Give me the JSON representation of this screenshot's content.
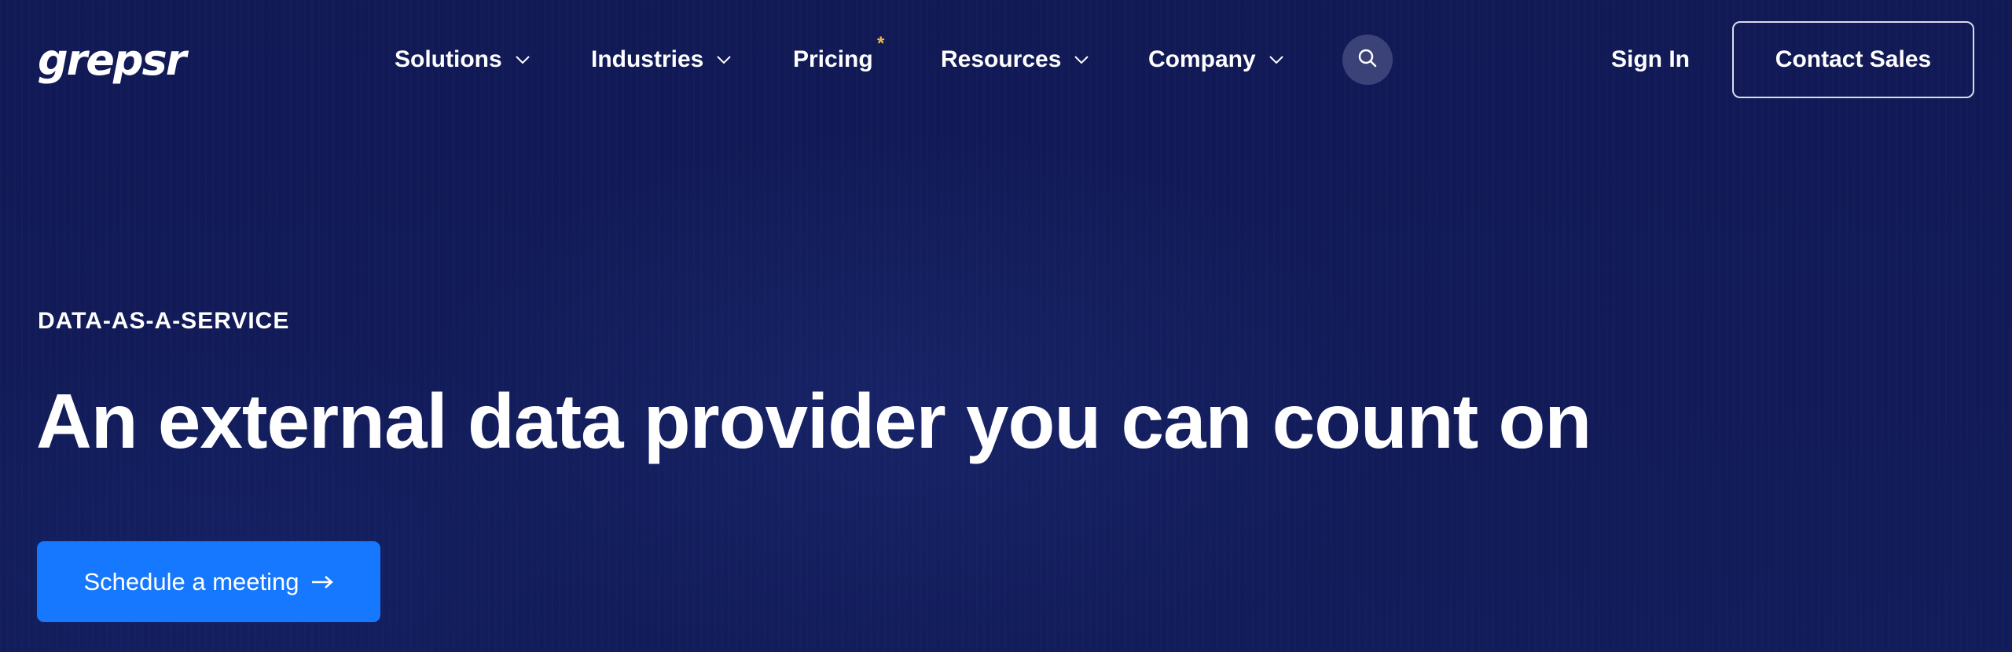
{
  "brand": {
    "logo_text": "grepsr"
  },
  "nav": {
    "items": [
      {
        "label": "Solutions",
        "has_dropdown": true
      },
      {
        "label": "Industries",
        "has_dropdown": true
      },
      {
        "label": "Pricing",
        "has_dropdown": false,
        "badge": "*"
      },
      {
        "label": "Resources",
        "has_dropdown": true
      },
      {
        "label": "Company",
        "has_dropdown": true
      }
    ],
    "search_icon": "search-icon",
    "sign_in_label": "Sign In",
    "contact_sales_label": "Contact Sales"
  },
  "hero": {
    "eyebrow": "DATA-AS-A-SERVICE",
    "headline": "An external data provider you can count on",
    "cta_label": "Schedule a meeting",
    "cta_icon": "arrow-right-icon"
  },
  "colors": {
    "background": "#111a55",
    "accent": "#1677ff",
    "badge": "#f2b94a",
    "search_bg": "#3b4278"
  }
}
